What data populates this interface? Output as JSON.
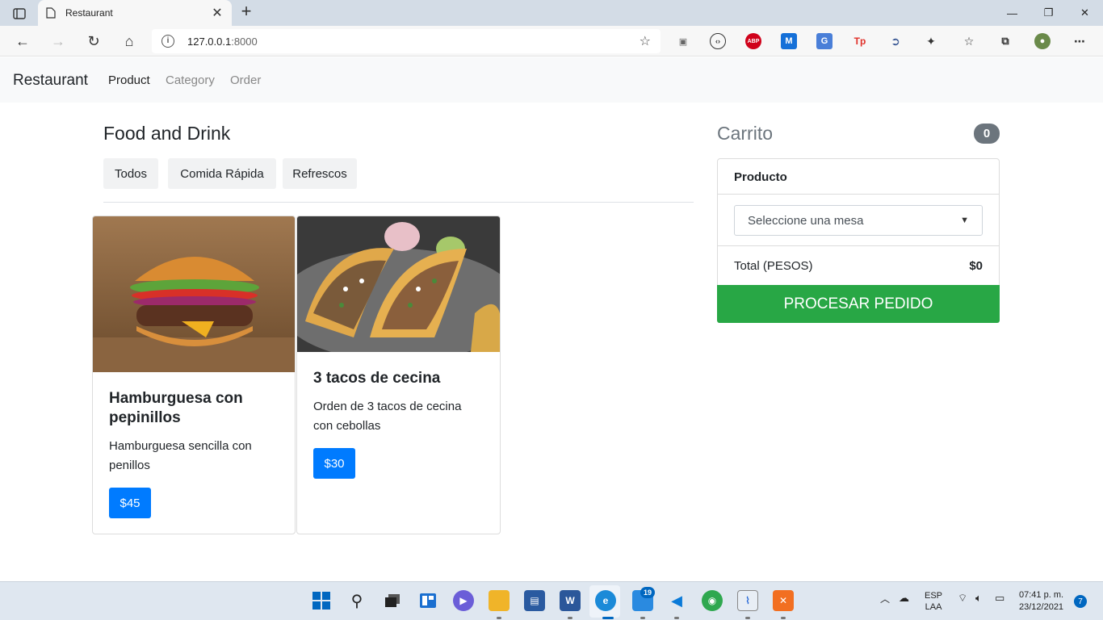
{
  "browser": {
    "tab_title": "Restaurant",
    "url_host": "127.0.0.1",
    "url_port": ":8000"
  },
  "navbar": {
    "brand": "Restaurant",
    "links": [
      "Product",
      "Category",
      "Order"
    ],
    "active_link": "Product"
  },
  "menu": {
    "title": "Food and Drink",
    "filters": [
      "Todos",
      "Comida Rápida",
      "Refrescos"
    ]
  },
  "products": [
    {
      "name": "Hamburguesa con pepinillos",
      "description": "Hamburguesa sencilla con penillos",
      "price": "$45",
      "image_icon": "burger-photo"
    },
    {
      "name": "3 tacos de cecina",
      "description": "Orden de 3 tacos de cecina con cebollas",
      "price": "$30",
      "image_icon": "tacos-photo"
    }
  ],
  "cart": {
    "title": "Carrito",
    "count": "0",
    "header": "Producto",
    "select_placeholder": "Seleccione una mesa",
    "total_label": "Total (PESOS)",
    "total_value": "$0",
    "process_label": "PROCESAR PEDIDO"
  },
  "taskbar": {
    "language": "ESP",
    "layout": "LAA",
    "time": "07:41 p. m.",
    "date": "23/12/2021",
    "notifications": "7",
    "store_badge": "19"
  },
  "colors": {
    "primary": "#007bff",
    "success": "#28a745",
    "secondary": "#6c757d"
  }
}
